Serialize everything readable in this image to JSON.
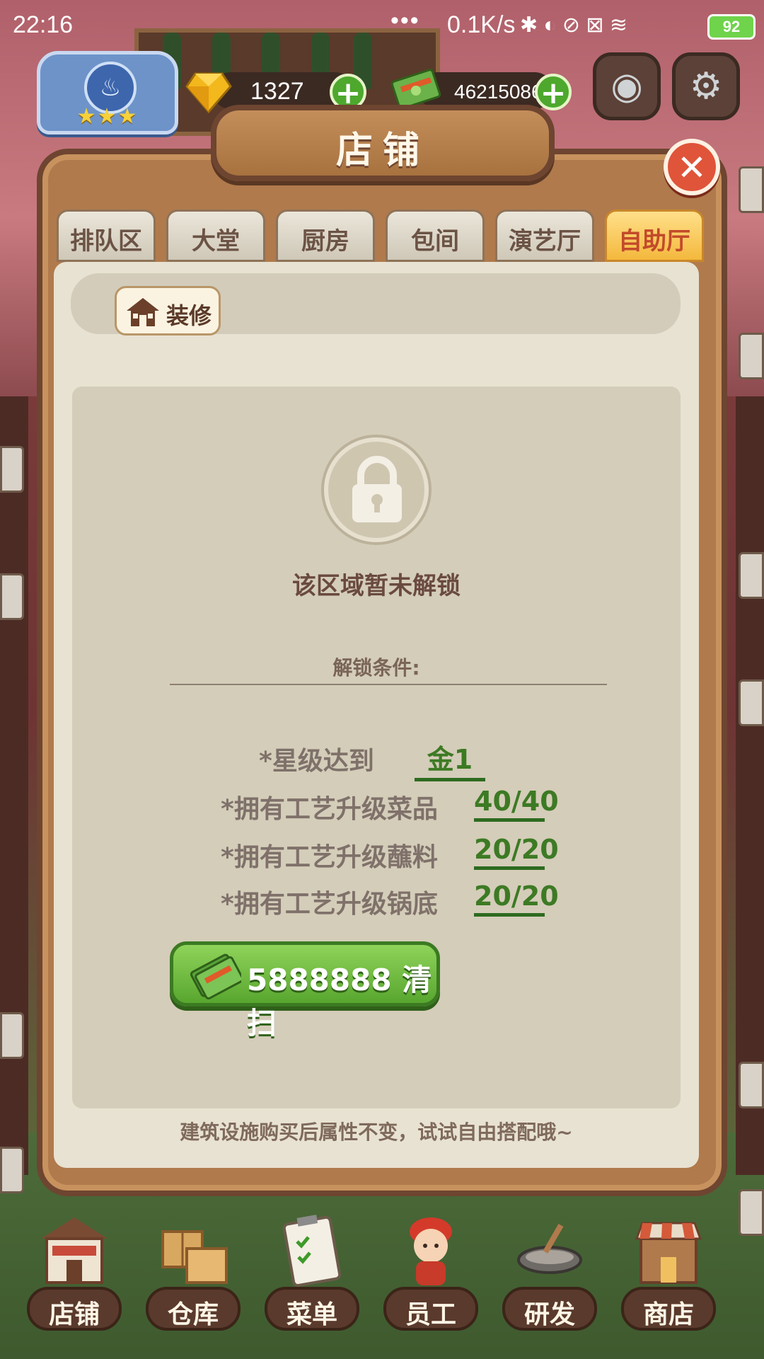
{
  "status_bar": {
    "time": "22:16",
    "dots": "•••",
    "net_speed": "0.1K/s",
    "icons": "✱ ◐ ⊘ ⊠ ≋",
    "battery": "92"
  },
  "hud": {
    "rating_stars": "★★★",
    "gems": "1327",
    "cash": "46215086",
    "plus": "+"
  },
  "modal": {
    "title": "店铺",
    "close": "✕",
    "tabs": [
      {
        "label": "排队区"
      },
      {
        "label": "大堂"
      },
      {
        "label": "厨房"
      },
      {
        "label": "包间"
      },
      {
        "label": "演艺厅"
      },
      {
        "label": "自助厅"
      }
    ],
    "active_tab_index": 5,
    "decorate_label": "装修",
    "locked_message": "该区域暂未解锁",
    "conditions_title": "解锁条件:",
    "conditions": [
      {
        "label": "*星级达到",
        "value": "金1"
      },
      {
        "label": "*拥有工艺升级菜品",
        "value": "40/40"
      },
      {
        "label": "*拥有工艺升级蘸料",
        "value": "20/20"
      },
      {
        "label": "*拥有工艺升级锅底",
        "value": "20/20"
      }
    ],
    "clean_button": "5888888 清扫",
    "hint": "建筑设施购买后属性不变，试试自由搭配哦~"
  },
  "bottom_nav": [
    {
      "label": "店铺",
      "icon": "shop-building-icon"
    },
    {
      "label": "仓库",
      "icon": "boxes-icon"
    },
    {
      "label": "菜单",
      "icon": "clipboard-icon"
    },
    {
      "label": "员工",
      "icon": "staff-girl-icon"
    },
    {
      "label": "研发",
      "icon": "wok-icon"
    },
    {
      "label": "商店",
      "icon": "store-icon"
    }
  ],
  "colors": {
    "active_tab": "#f4b83d",
    "condition_value": "#3d7a24",
    "clean_button": "#58a62f",
    "close_button": "#e0543a"
  }
}
